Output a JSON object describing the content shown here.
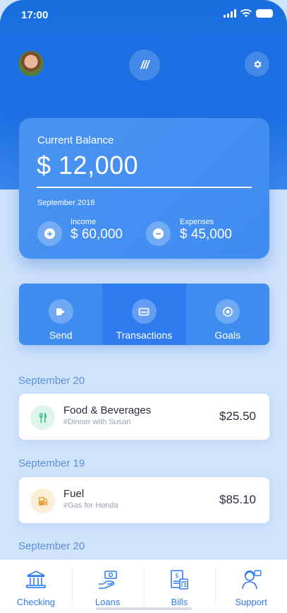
{
  "status_bar": {
    "time": "17:00"
  },
  "header": {
    "logo_text": "///"
  },
  "balance": {
    "label": "Current Balance",
    "amount": "$ 12,000",
    "period": "September 2018",
    "income": {
      "label": "Income",
      "value": "$ 60,000"
    },
    "expenses": {
      "label": "Expenses",
      "value": "$ 45,000"
    }
  },
  "actions": [
    {
      "label": "Send",
      "icon": "send-icon"
    },
    {
      "label": "Transactions",
      "icon": "card-icon"
    },
    {
      "label": "Goals",
      "icon": "target-icon"
    }
  ],
  "transactions": [
    {
      "date": "September 20",
      "title": "Food & Beverages",
      "note": "#Dinner with Susan",
      "amount": "$25.50",
      "icon": "fork-knife-icon",
      "icon_color": "#3ec28f",
      "icon_bg": "#dff5ec"
    },
    {
      "date": "September 19",
      "title": "Fuel",
      "note": "#Gas for Honda",
      "amount": "$85.10",
      "icon": "fuel-icon",
      "icon_color": "#e7a53b",
      "icon_bg": "#fbeed6"
    },
    {
      "date": "September 20"
    }
  ],
  "tabbar": [
    {
      "label": "Checking",
      "icon": "bank-icon"
    },
    {
      "label": "Loans",
      "icon": "money-hand-icon"
    },
    {
      "label": "Bills",
      "icon": "bill-icon"
    },
    {
      "label": "Support",
      "icon": "support-agent-icon"
    }
  ],
  "colors": {
    "primary": "#2f7cf0",
    "card": "#3f8cf1",
    "background": "#cfe3fb"
  }
}
